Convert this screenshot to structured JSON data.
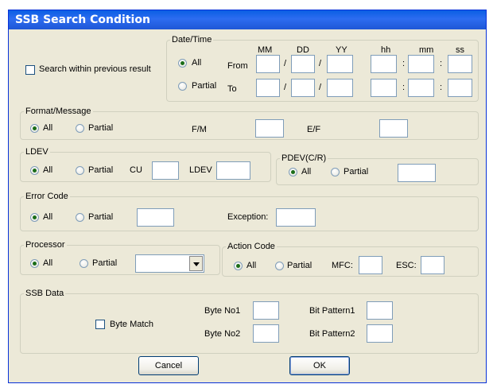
{
  "window": {
    "title": "SSB Search Condition"
  },
  "search_within": {
    "label": "Search within previous result",
    "checked": false
  },
  "datetime": {
    "legend": "Date/Time",
    "col_headers": [
      "MM",
      "DD",
      "YY",
      "hh",
      "mm",
      "ss"
    ],
    "radio_all": "All",
    "radio_partial": "Partial",
    "selected": "All",
    "from_label": "From",
    "to_label": "To",
    "date_sep": "/",
    "time_sep": ":"
  },
  "format_message": {
    "legend": "Format/Message",
    "radio_all": "All",
    "radio_partial": "Partial",
    "selected": "All",
    "fm_label": "F/M",
    "ef_label": "E/F"
  },
  "ldev": {
    "legend": "LDEV",
    "radio_all": "All",
    "radio_partial": "Partial",
    "selected": "All",
    "cu_label": "CU",
    "ldev_label": "LDEV"
  },
  "pdev": {
    "legend": "PDEV(C/R)",
    "radio_all": "All",
    "radio_partial": "Partial",
    "selected": "All"
  },
  "error_code": {
    "legend": "Error Code",
    "radio_all": "All",
    "radio_partial": "Partial",
    "selected": "All",
    "exception_label": "Exception:"
  },
  "processor": {
    "legend": "Processor",
    "radio_all": "All",
    "radio_partial": "Partial",
    "selected": "All",
    "combo_value": ""
  },
  "action_code": {
    "legend": "Action Code",
    "radio_all": "All",
    "radio_partial": "Partial",
    "selected": "All",
    "mfc_label": "MFC:",
    "esc_label": "ESC:"
  },
  "ssb_data": {
    "legend": "SSB Data",
    "byte_match_label": "Byte Match",
    "byte_match_checked": false,
    "byte_no1_label": "Byte No1",
    "byte_no2_label": "Byte No2",
    "bit_pattern1_label": "Bit Pattern1",
    "bit_pattern2_label": "Bit Pattern2"
  },
  "buttons": {
    "cancel": "Cancel",
    "ok": "OK"
  }
}
